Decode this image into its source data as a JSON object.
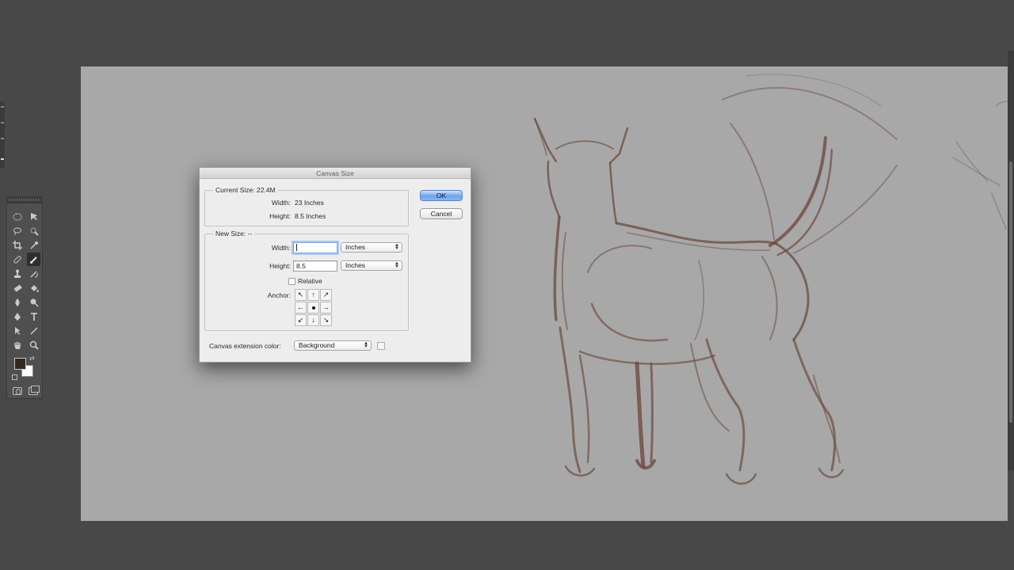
{
  "dialog": {
    "title": "Canvas Size",
    "current_size": {
      "title": "Current Size: 22.4M",
      "width_label": "Width:",
      "width_value": "23 Inches",
      "height_label": "Height:",
      "height_value": "8.5 Inches"
    },
    "new_size": {
      "title": "New Size: --",
      "width_label": "Width:",
      "width_value": "",
      "width_unit": "Inches",
      "height_label": "Height:",
      "height_value": "8.5",
      "height_unit": "Inches",
      "relative_label": "Relative",
      "relative_checked": false,
      "anchor_label": "Anchor:",
      "anchor_selected": "center"
    },
    "extension_color_label": "Canvas extension color:",
    "extension_color_value": "Background",
    "ok_label": "OK",
    "cancel_label": "Cancel"
  },
  "tools": {
    "foreground_color": "#332820",
    "background_color": "#ffffff",
    "items": [
      "marquee-icon",
      "move-icon",
      "lasso-icon",
      "quick-selection-icon",
      "crop-icon",
      "eyedropper-icon",
      "healing-icon",
      "brush-icon",
      "stamp-icon",
      "history-brush-icon",
      "eraser-icon",
      "paint-bucket-icon",
      "blur-icon",
      "dodge-icon",
      "pen-icon",
      "type-icon",
      "path-selection-icon",
      "line-icon",
      "hand-icon",
      "zoom-icon"
    ]
  },
  "theme": {
    "workspace": "#484848",
    "canvas": "#a8a8a8",
    "sketch_stroke": "#6e4a3e"
  }
}
